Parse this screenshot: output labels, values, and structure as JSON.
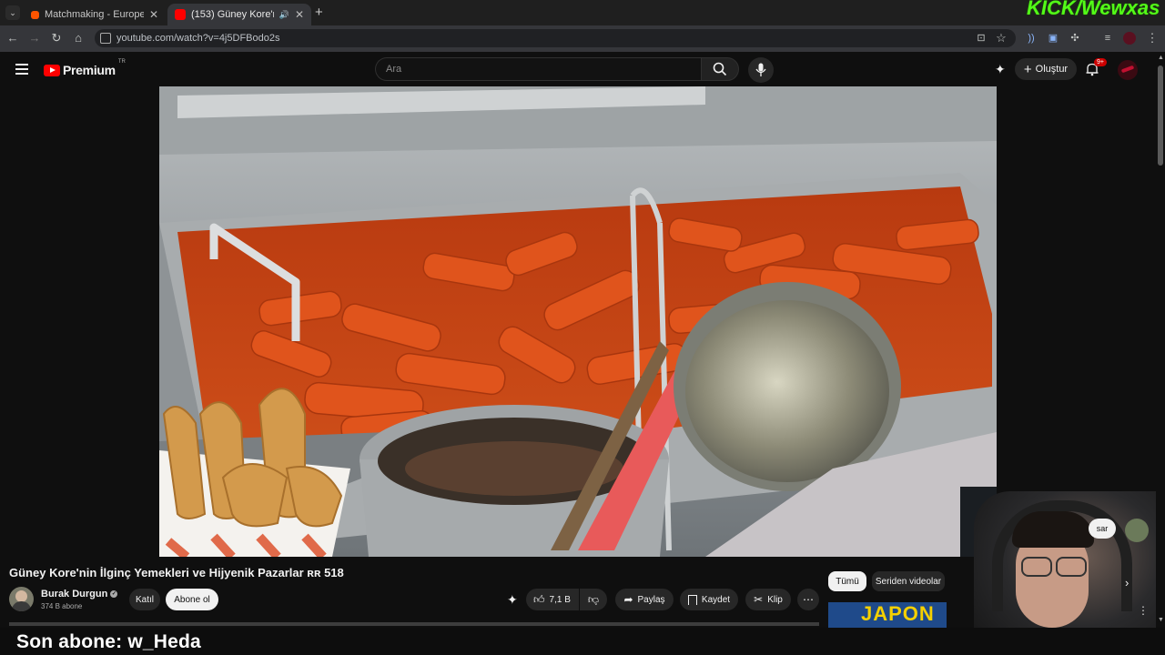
{
  "browser": {
    "tabs": [
      {
        "title": "Matchmaking - Europe 5v5 Qu"
      },
      {
        "title": "(153) Güney Kore'nin İlginç"
      }
    ],
    "url": "youtube.com/watch?v=4j5DFBodo2s"
  },
  "stream_overlay": {
    "logo_text": "KICK/Wewxas",
    "last_subscriber": "Son abone: w_Heda"
  },
  "youtube": {
    "logo": "Premium",
    "logo_region": "TR",
    "search_placeholder": "Ara",
    "create_label": "Oluştur",
    "notification_count": "9+",
    "video": {
      "title": "Güney Kore'nin İlginç Yemekleri ve Hijyenik Pazarlar",
      "title_suffix": "ʀʀ 518",
      "channel": "Burak Durgun",
      "subscribers": "374 B abone",
      "join_label": "Katıl",
      "subscribe_label": "Abone ol",
      "likes": "7,1 B",
      "share_label": "Paylaş",
      "save_label": "Kaydet",
      "clip_label": "Klip"
    },
    "chips": [
      "Tümü",
      "Seriden videolar"
    ],
    "side_popup_label": "sar",
    "recommended_thumb_text": "JAPON"
  },
  "colors": {
    "yt_red": "#ff0000",
    "kick_green": "#53fc18"
  }
}
